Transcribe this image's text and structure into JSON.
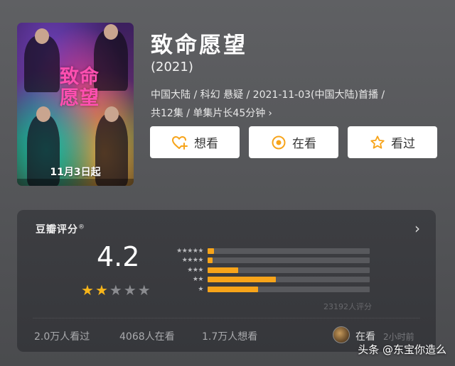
{
  "poster": {
    "title_text": "致命愿望",
    "date_text": "11月3日起"
  },
  "movie": {
    "title": "致命愿望",
    "year": "(2021)",
    "meta_line1": "中国大陆 / 科幻 悬疑 / 2021-11-03(中国大陆)首播 /",
    "meta_line2": "共12集 / 单集片长45分钟",
    "meta_chevron": "›"
  },
  "actions": {
    "want_label": "想看",
    "watching_label": "在看",
    "watched_label": "看过"
  },
  "rating": {
    "source_label": "豆瓣评分",
    "registered_mark": "®",
    "arrow": "›",
    "score": "4.2",
    "stars_filled": 2,
    "stars_total": 5,
    "distribution": [
      {
        "stars": "★★★★★",
        "fraction": 0.04
      },
      {
        "stars": "★★★★",
        "fraction": 0.03
      },
      {
        "stars": "★★★",
        "fraction": 0.19
      },
      {
        "stars": "★★",
        "fraction": 0.42
      },
      {
        "stars": "★",
        "fraction": 0.31
      }
    ],
    "total_ratings": "23192人评分",
    "watched_count": "2.0万人看过",
    "watching_count": "4068人在看",
    "want_count": "1.7万人想看",
    "user_status": "在看",
    "user_time": "2小时前"
  },
  "watermark": "头条 @东宝你造么",
  "colors": {
    "accent": "#f7a41a",
    "star_off": "#8a8b8f",
    "card_bg": "#3d3e42"
  }
}
